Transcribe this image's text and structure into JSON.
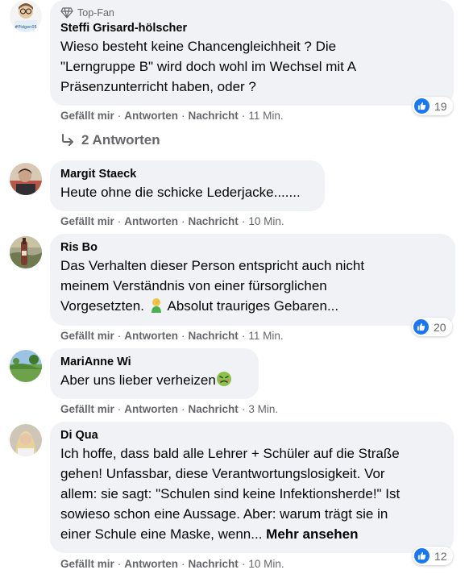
{
  "action_labels": {
    "like": "Gefällt mir",
    "reply": "Antworten",
    "message": "Nachricht",
    "separator": "·"
  },
  "comments": [
    {
      "badge": "Top-Fan",
      "author": "Steffi Grisard-hölscher",
      "text_lines": [
        "Wieso besteht keine Chancengleichheit ? Die",
        "\"Lerngruppe B\" wird doch wohl im Wechsel mit A",
        "Präsenzunterricht haben, oder ?"
      ],
      "time": "11 Min.",
      "reactions": "19",
      "replies": "2 Antworten",
      "avatar_caption": "#Pidgen05"
    },
    {
      "author": "Margit Staeck",
      "text_lines": [
        "Heute ohne die schicke Lederjacke......."
      ],
      "time": "10 Min."
    },
    {
      "author": "Ris Bo",
      "text_lines": [
        "Das Verhalten dieser Person entspricht auch nicht",
        "meinem Verständnis von einer fürsorglichen",
        "Vorgesetzten.",
        "Absolut trauriges Gebaren..."
      ],
      "time": "11 Min.",
      "reactions": "20"
    },
    {
      "author": "MariAnne Wi",
      "text_lines": [
        "Aber uns lieber verheizen"
      ],
      "time": "3 Min."
    },
    {
      "author": "Di Qua",
      "text_lines": [
        "Ich hoffe, dass bald alle Lehrer + Schüler auf die Straße",
        "gehen! Unfassbar, diese Verantwortungslosigkeit. Vor",
        "allem: sie sagt: \"Schulen sind keine Infektionsherde!\" Ist",
        "sowieso schon eine Aussage. Aber: warum trägt sie in",
        "einer Schule eine Maske, wenn..."
      ],
      "see_more": "Mehr ansehen",
      "time": "10 Min.",
      "reactions": "12"
    }
  ],
  "colors": {
    "bubble": "#f0f2f5",
    "meta": "#65676b",
    "like_blue": "#1877f2"
  },
  "icons": [
    "diamond-icon",
    "reply-arrow-icon",
    "thumbs-up-icon",
    "facepalm-emoji",
    "nauseated-emoji"
  ]
}
